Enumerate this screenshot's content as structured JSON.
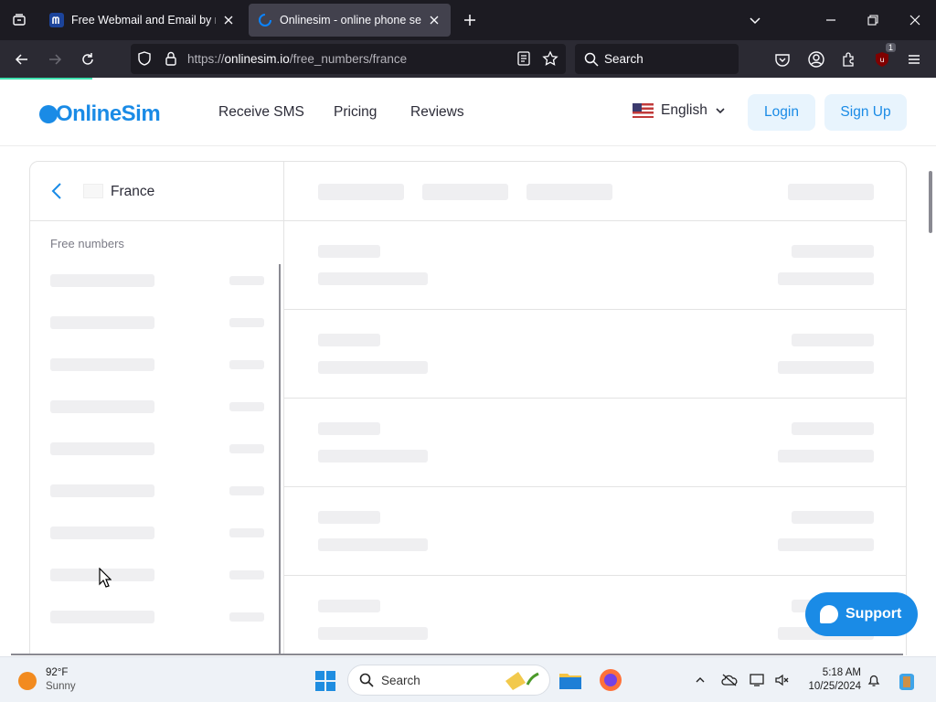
{
  "browser": {
    "tabs": [
      {
        "title": "Free Webmail and Email by mail.com",
        "active": false
      },
      {
        "title": "Onlinesim - online phone service",
        "active": true
      }
    ],
    "url_prefix": "https://",
    "url_host": "onlinesim.io",
    "url_path": "/free_numbers/france",
    "search_placeholder": "Search",
    "extensions_badge": "1",
    "accent_color": "#3fe1b0"
  },
  "site": {
    "logo_text": "OnlineSim",
    "brand_color": "#1a8be6",
    "nav": [
      {
        "label": "Receive SMS"
      },
      {
        "label": "Pricing"
      },
      {
        "label": "Reviews"
      }
    ],
    "language": "English",
    "login_label": "Login",
    "signup_label": "Sign Up"
  },
  "content": {
    "country": "France",
    "free_numbers_label": "Free numbers",
    "loading": true
  },
  "support_label": "Support",
  "taskbar": {
    "weather_temp": "92°F",
    "weather_desc": "Sunny",
    "search_placeholder": "Search",
    "time": "5:18 AM",
    "date": "10/25/2024"
  }
}
